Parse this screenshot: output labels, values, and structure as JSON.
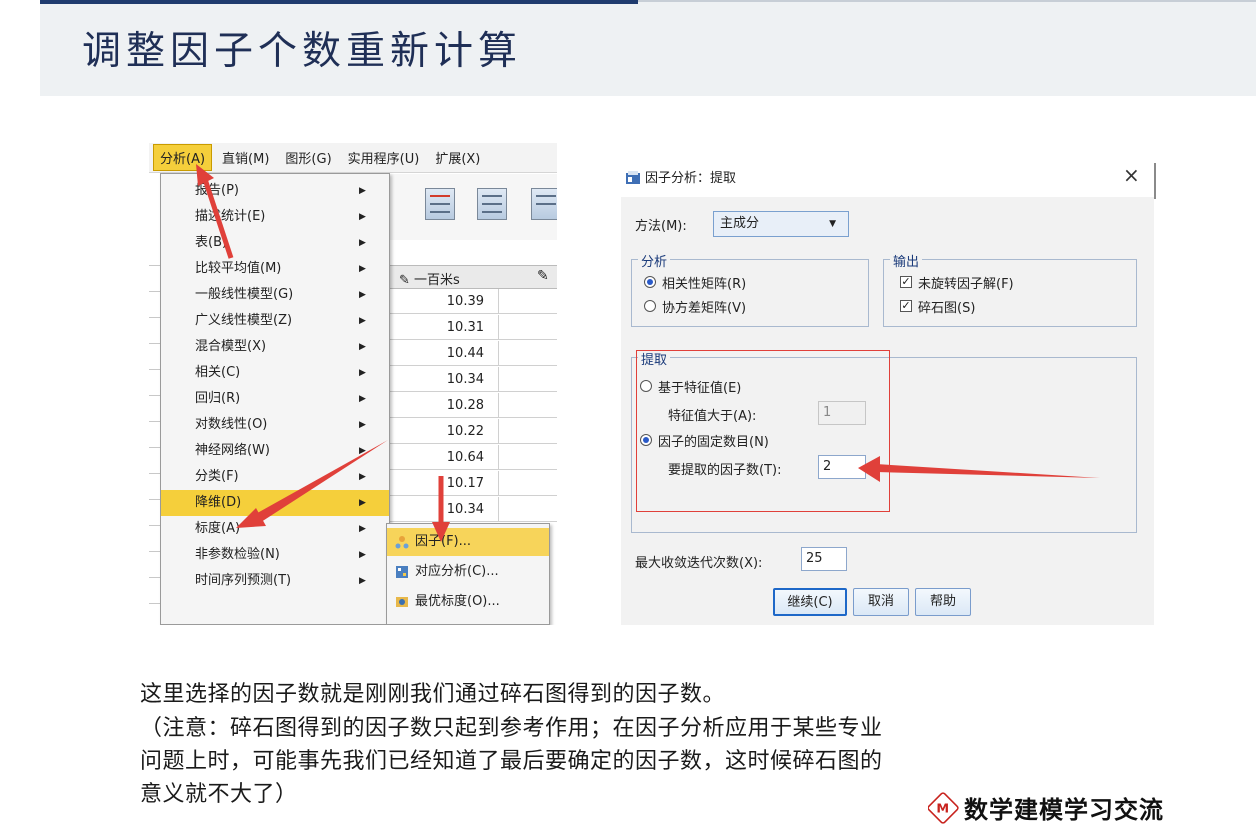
{
  "slide": {
    "title": "调整因子个数重新计算",
    "paragraph_lines": [
      "这里选择的因子数就是刚刚我们通过碎石图得到的因子数。",
      "（注意：碎石图得到的因子数只起到参考作用；在因子分析应用于某些专业",
      "问题上时，可能事先我们已经知道了最后要确定的因子数，这时候碎石图的",
      "意义就不大了）"
    ],
    "logo_text": "数学建模学习交流",
    "logo_mark": "M",
    "accent_color": "#1f3b6e",
    "annotation_color": "#e0403a"
  },
  "spss_window": {
    "menubar": [
      "分析(A)",
      "直销(M)",
      "图形(G)",
      "实用程序(U)",
      "扩展(X)"
    ],
    "column_header": "一百米s",
    "column_values": [
      "10.39",
      "10.31",
      "10.44",
      "10.34",
      "10.28",
      "10.22",
      "10.64",
      "10.17",
      "10.34"
    ],
    "analyze_menu": [
      "报告(P)",
      "描述统计(E)",
      "表(B)",
      "比较平均值(M)",
      "一般线性模型(G)",
      "广义线性模型(Z)",
      "混合模型(X)",
      "相关(C)",
      "回归(R)",
      "对数线性(O)",
      "神经网络(W)",
      "分类(F)",
      "降维(D)",
      "标度(A)",
      "非参数检验(N)",
      "时间序列预测(T)"
    ],
    "highlighted_menu_item": "降维(D)",
    "submenu": [
      "因子(F)...",
      "对应分析(C)...",
      "最优标度(O)..."
    ]
  },
  "dialog": {
    "title": "因子分析：提取",
    "close_glyph": "×",
    "method_label": "方法(M):",
    "method_value": "主成分",
    "analyze_group": {
      "title": "分析",
      "options": [
        "相关性矩阵(R)",
        "协方差矩阵(V)"
      ],
      "selected": "相关性矩阵(R)"
    },
    "output_group": {
      "title": "输出",
      "checkboxes": [
        "未旋转因子解(F)",
        "碎石图(S)"
      ],
      "checked": [
        true,
        true
      ]
    },
    "extract_group": {
      "title": "提取",
      "option_eigen": "基于特征值(E)",
      "eigen_label": "特征值大于(A):",
      "eigen_value": "1",
      "option_fixed": "因子的固定数目(N)",
      "fixed_label": "要提取的因子数(T):",
      "fixed_value": "2",
      "selected": "因子的固定数目(N)"
    },
    "max_iter_label": "最大收敛迭代次数(X):",
    "max_iter_value": "25",
    "buttons": [
      "继续(C)",
      "取消",
      "帮助"
    ]
  }
}
